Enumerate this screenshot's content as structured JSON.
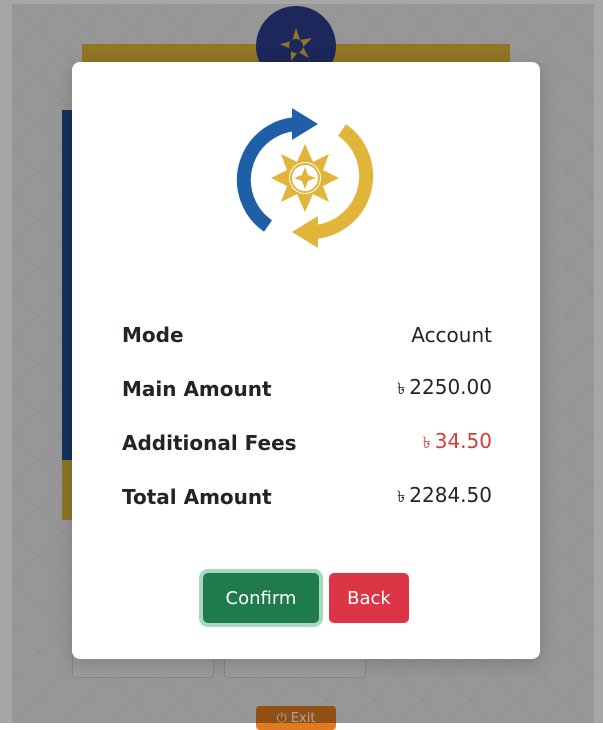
{
  "background": {
    "exit_label": "Exit"
  },
  "modal": {
    "details": [
      {
        "label": "Mode",
        "value": "Account",
        "currency": ""
      },
      {
        "label": "Main Amount",
        "value": "2250.00",
        "currency": "৳"
      },
      {
        "label": "Additional Fees",
        "value": "34.50",
        "currency": "৳"
      },
      {
        "label": "Total Amount",
        "value": "2284.50",
        "currency": "৳"
      }
    ],
    "confirm_label": "Confirm",
    "back_label": "Back"
  },
  "colors": {
    "brand_blue": "#1f5fa8",
    "brand_gold": "#e0b53a",
    "confirm_green": "#1f7a4c",
    "back_red": "#dc3545",
    "fee_red": "#d63b3b"
  },
  "icons": [
    "exchange-logo-icon",
    "power-icon"
  ]
}
